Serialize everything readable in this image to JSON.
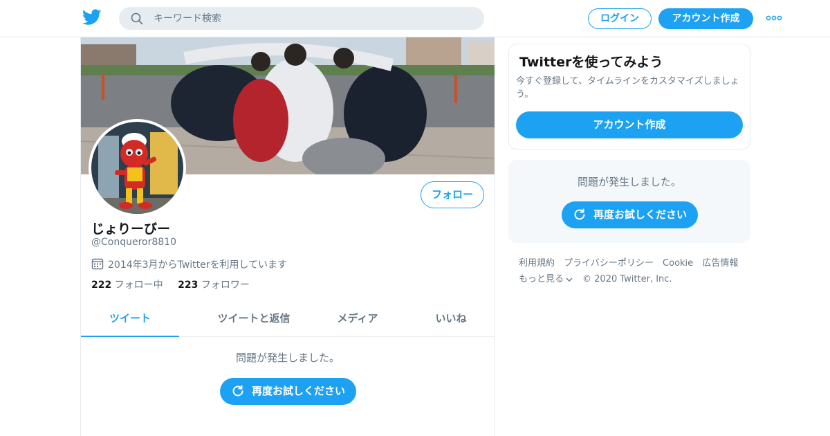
{
  "header": {
    "search_placeholder": "キーワード検索",
    "login_label": "ログイン",
    "signup_label": "アカウント作成",
    "logo_icon": "twitter-bird-icon",
    "more_icon": "more-dots-icon",
    "search_icon": "search-icon",
    "accent_color": "#1da1f2"
  },
  "profile": {
    "display_name": "じょりーびー",
    "handle": "@Conqueror8810",
    "joined": "2014年3月からTwitterを利用しています",
    "joined_icon": "calendar-icon",
    "follow_label": "フォロー",
    "following_count": "222",
    "following_label": "フォロー中",
    "followers_count": "223",
    "followers_label": "フォロワー"
  },
  "tabs": [
    {
      "label": "ツイート",
      "active": true
    },
    {
      "label": "ツイートと返信",
      "active": false
    },
    {
      "label": "メディア",
      "active": false
    },
    {
      "label": "いいね",
      "active": false
    }
  ],
  "timeline": {
    "error_message": "問題が発生しました。",
    "retry_label": "再度お試しください",
    "retry_icon": "refresh-icon"
  },
  "sidebar": {
    "signup_card": {
      "title": "Twitterを使ってみよう",
      "description": "今すぐ登録して、タイムラインをカスタマイズしましょう。",
      "button_label": "アカウント作成"
    },
    "error_card": {
      "message": "問題が発生しました。",
      "retry_label": "再度お試しください"
    },
    "footer": {
      "links": [
        "利用規約",
        "プライバシーポリシー",
        "Cookie",
        "広告情報"
      ],
      "more_label": "もっと見る",
      "copyright": "© 2020 Twitter, Inc."
    }
  }
}
